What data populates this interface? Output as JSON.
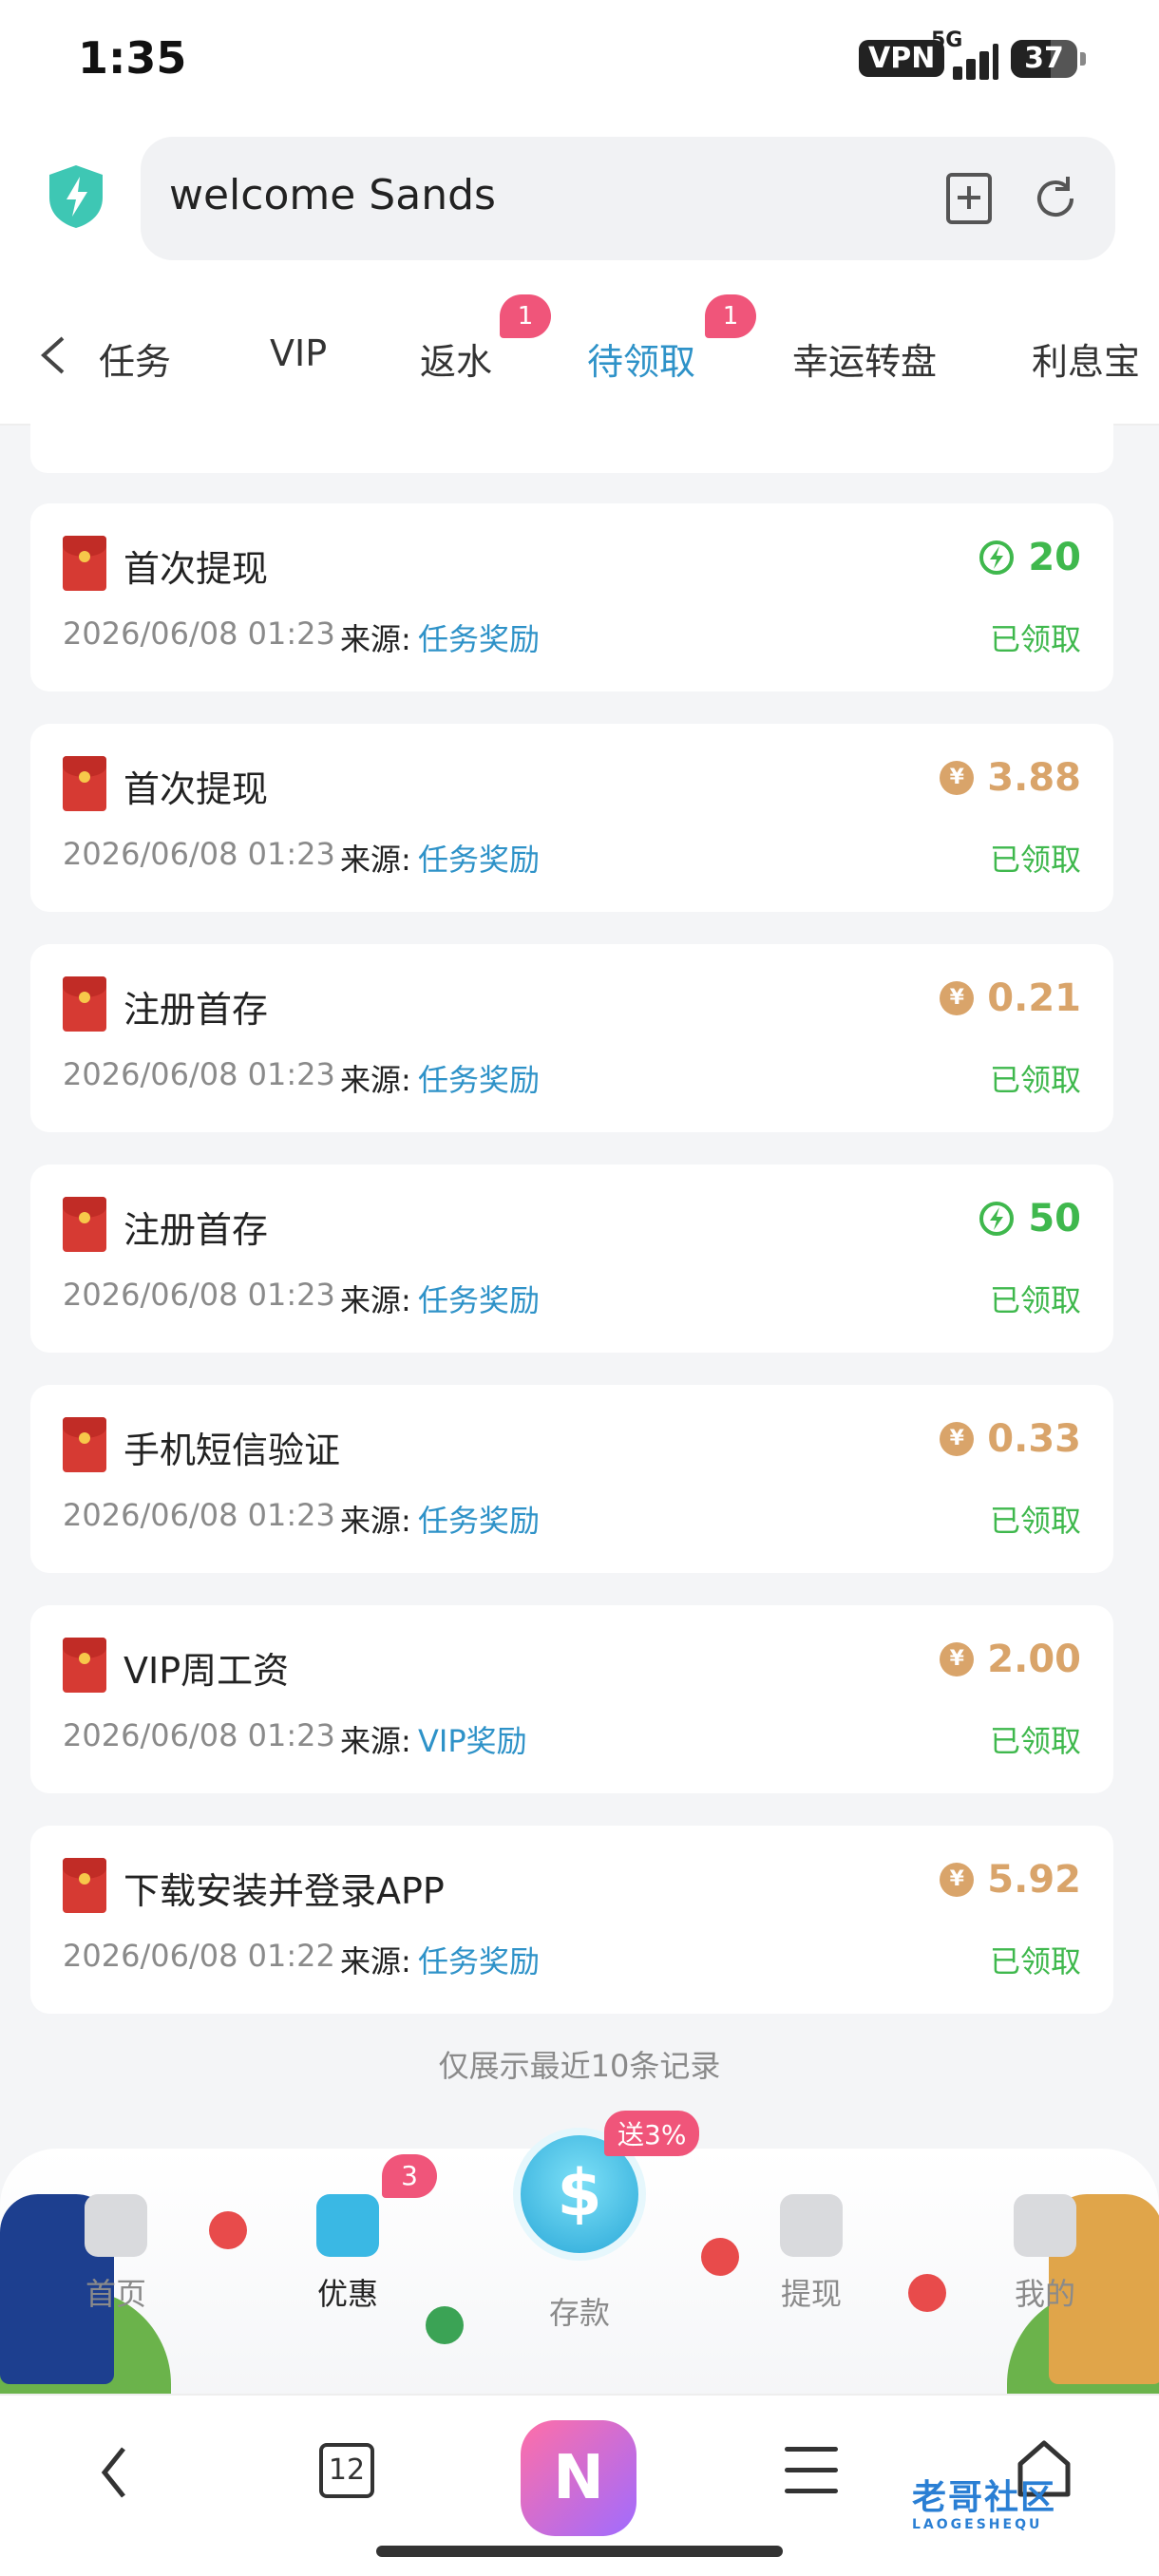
{
  "status_bar": {
    "time": "1:35",
    "vpn": "VPN",
    "network": "5G",
    "battery": "37"
  },
  "address_bar": {
    "url_text": "welcome Sands"
  },
  "tabs": [
    {
      "label": "任务",
      "active": false,
      "badge": ""
    },
    {
      "label": "VIP",
      "active": false,
      "badge": ""
    },
    {
      "label": "返水",
      "active": false,
      "badge": "1"
    },
    {
      "label": "待领取",
      "active": true,
      "badge": "1"
    },
    {
      "label": "幸运转盘",
      "active": false,
      "badge": ""
    },
    {
      "label": "利息宝",
      "active": false,
      "badge": ""
    }
  ],
  "records": [
    {
      "title": "首次提现",
      "date": "2026/06/08 01:23",
      "source_label": "来源:",
      "source": "任务奖励",
      "amount": "20",
      "currency": "bolt",
      "status": "已领取"
    },
    {
      "title": "首次提现",
      "date": "2026/06/08 01:23",
      "source_label": "来源:",
      "source": "任务奖励",
      "amount": "3.88",
      "currency": "coin",
      "status": "已领取"
    },
    {
      "title": "注册首存",
      "date": "2026/06/08 01:23",
      "source_label": "来源:",
      "source": "任务奖励",
      "amount": "0.21",
      "currency": "coin",
      "status": "已领取"
    },
    {
      "title": "注册首存",
      "date": "2026/06/08 01:23",
      "source_label": "来源:",
      "source": "任务奖励",
      "amount": "50",
      "currency": "bolt",
      "status": "已领取"
    },
    {
      "title": "手机短信验证",
      "date": "2026/06/08 01:23",
      "source_label": "来源:",
      "source": "任务奖励",
      "amount": "0.33",
      "currency": "coin",
      "status": "已领取"
    },
    {
      "title": "VIP周工资",
      "date": "2026/06/08 01:23",
      "source_label": "来源:",
      "source": "VIP奖励",
      "amount": "2.00",
      "currency": "coin",
      "status": "已领取"
    },
    {
      "title": "下载安装并登录APP",
      "date": "2026/06/08 01:22",
      "source_label": "来源:",
      "source": "任务奖励",
      "amount": "5.92",
      "currency": "coin",
      "status": "已领取"
    }
  ],
  "coin_symbol": "¥",
  "footer_note": "仅展示最近10条记录",
  "app_nav": {
    "home": "首页",
    "promo": "优惠",
    "promo_badge": "3",
    "deposit": "存款",
    "deposit_tag": "送3%",
    "withdraw": "提现",
    "mine": "我的"
  },
  "browser_bar": {
    "tab_count": "12",
    "app_letter": "N"
  },
  "watermark": {
    "text": "老哥社区",
    "sub": "LAOGESHEQU"
  },
  "colors": {
    "accent": "#2e92c8",
    "green": "#3fb84d",
    "gold": "#d9a46a",
    "badge": "#f0557a"
  }
}
